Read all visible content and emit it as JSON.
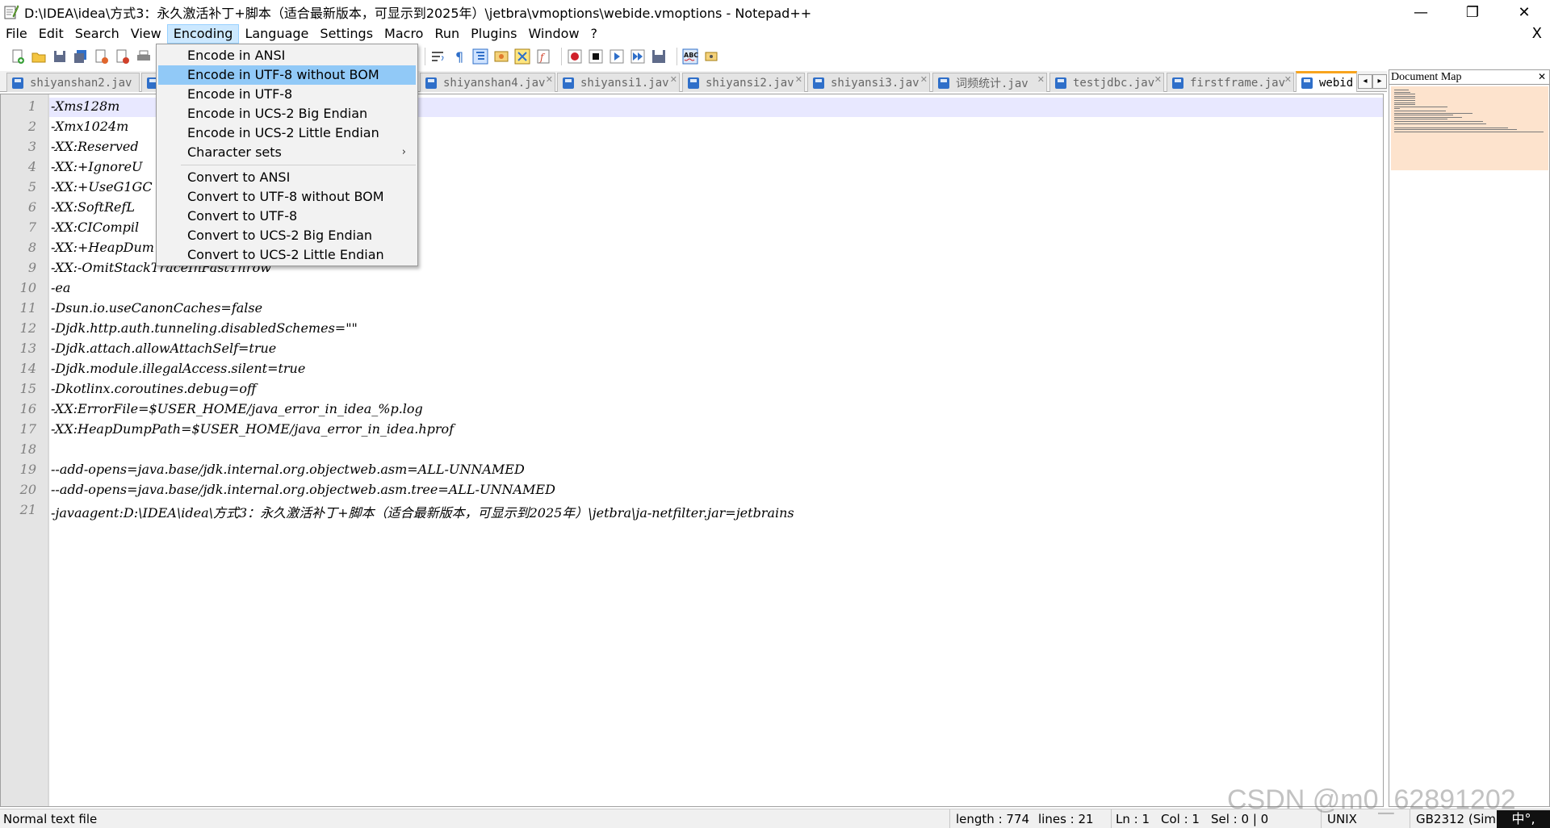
{
  "window": {
    "title": "D:\\IDEA\\idea\\方式3：永久激活补丁+脚本（适合最新版本，可显示到2025年）\\jetbra\\vmoptions\\webide.vmoptions - Notepad++",
    "min_glyph": "—",
    "max_glyph": "❐",
    "close_glyph": "✕"
  },
  "menubar": {
    "items": [
      "File",
      "Edit",
      "Search",
      "View",
      "Encoding",
      "Language",
      "Settings",
      "Macro",
      "Run",
      "Plugins",
      "Window",
      "?"
    ],
    "active": "Encoding",
    "close": "X"
  },
  "tabs": [
    {
      "label": "shiyanshan2.jav",
      "active": false
    },
    {
      "label": "shiyanshan4.jav",
      "active": false
    },
    {
      "label": "shiyansi1.jav",
      "active": false
    },
    {
      "label": "shiyansi2.jav",
      "active": false
    },
    {
      "label": "shiyansi3.jav",
      "active": false
    },
    {
      "label": "词频统计.jav",
      "active": false
    },
    {
      "label": "testjdbc.jav",
      "active": false
    },
    {
      "label": "firstframe.jav",
      "active": false
    },
    {
      "label": "webid",
      "active": true
    }
  ],
  "tab_scroll": {
    "left": "◂",
    "right": "▸"
  },
  "editor": {
    "line_numbers": [
      "1",
      "2",
      "3",
      "4",
      "5",
      "6",
      "7",
      "8",
      "9",
      "10",
      "11",
      "12",
      "13",
      "14",
      "15",
      "16",
      "17",
      "18",
      "19",
      "20",
      "21"
    ],
    "lines": [
      "-Xms128m",
      "-Xmx1024m",
      "-XX:Reserved",
      "-XX:+IgnoreU",
      "-XX:+UseG1GC",
      "-XX:SoftRefL",
      "-XX:CICompil",
      "-XX:+HeapDum",
      "-XX:-OmitStackTraceInFastThrow",
      "-ea",
      "-Dsun.io.useCanonCaches=false",
      "-Djdk.http.auth.tunneling.disabledSchemes=\"\"",
      "-Djdk.attach.allowAttachSelf=true",
      "-Djdk.module.illegalAccess.silent=true",
      "-Dkotlinx.coroutines.debug=off",
      "-XX:ErrorFile=$USER_HOME/java_error_in_idea_%p.log",
      "-XX:HeapDumpPath=$USER_HOME/java_error_in_idea.hprof",
      "",
      "--add-opens=java.base/jdk.internal.org.objectweb.asm=ALL-UNNAMED",
      "--add-opens=java.base/jdk.internal.org.objectweb.asm.tree=ALL-UNNAMED",
      "-javaagent:D:\\IDEA\\idea\\方式3：永久激活补丁+脚本（适合最新版本，可显示到2025年）\\jetbra\\ja-netfilter.jar=jetbrains"
    ]
  },
  "encoding_menu": {
    "items": [
      {
        "label": "Encode in ANSI"
      },
      {
        "label": "Encode in UTF-8 without BOM",
        "highlighted": true
      },
      {
        "label": "Encode in UTF-8"
      },
      {
        "label": "Encode in UCS-2 Big Endian"
      },
      {
        "label": "Encode in UCS-2 Little Endian"
      },
      {
        "label": "Character sets",
        "submenu": true
      },
      {
        "separator": true
      },
      {
        "label": "Convert to ANSI"
      },
      {
        "label": "Convert to UTF-8 without BOM"
      },
      {
        "label": "Convert to UTF-8"
      },
      {
        "label": "Convert to UCS-2 Big Endian"
      },
      {
        "label": "Convert to UCS-2 Little Endian"
      }
    ],
    "submenu_arrow": "›"
  },
  "document_map": {
    "title": "Document Map",
    "close": "✕"
  },
  "statusbar": {
    "file_type": "Normal text file",
    "length": "length : 774",
    "lines": "lines : 21",
    "ln": "Ln : 1",
    "col": "Col : 1",
    "sel": "Sel : 0 | 0",
    "eol": "UNIX",
    "encoding": "GB2312 (Simp"
  },
  "watermark": "CSDN @m0_62891202",
  "ime_indicator": "中°,",
  "icons": {
    "app": "notepad-plus-plus-icon",
    "toolbar": [
      "new-file-icon",
      "open-file-icon",
      "save-icon",
      "save-all-icon",
      "close-icon",
      "close-all-icon",
      "print-icon",
      "wrap-icon",
      "all-chars-icon",
      "indent-guide-icon",
      "user-lang-icon",
      "doc-map-icon",
      "function-list-icon",
      "record-macro-icon",
      "stop-record-icon",
      "play-macro-icon",
      "run-macro-multiple-icon",
      "save-macro-icon",
      "spellcheck-icon",
      "spellcheck-options-icon"
    ]
  },
  "colors": {
    "menu_highlight": "#91c9f7",
    "menubar_active": "#cce8ff",
    "active_tab_accent": "#f8a41d",
    "gutter": "#e4e4e4",
    "current_line": "#e8e8ff",
    "docmap_view": "#fde3cd"
  }
}
